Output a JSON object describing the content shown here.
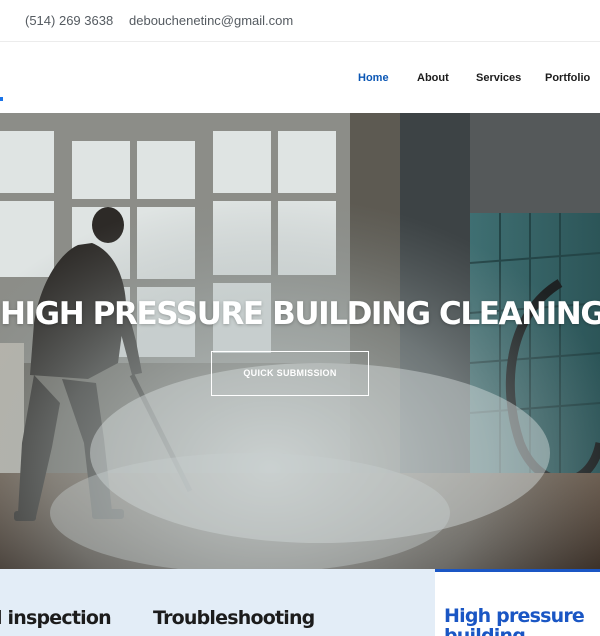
{
  "topbar": {
    "left_fragment": "l",
    "phone": "(514) 269 3638",
    "email": "debouchenetinc@gmail.com"
  },
  "nav": {
    "items": [
      {
        "label": "Home",
        "active": true
      },
      {
        "label": "About",
        "active": false
      },
      {
        "label": "Services",
        "active": false
      },
      {
        "label": "Portfolio",
        "active": false
      }
    ]
  },
  "hero": {
    "title": "HIGH PRESSURE BUILDING CLEANING",
    "button_label": "QUICK SUBMISSION"
  },
  "bottom": {
    "items": [
      {
        "title": "l inspection"
      },
      {
        "title": "Troubleshooting"
      },
      {
        "title": "High pressure building cleaning"
      }
    ]
  },
  "colors": {
    "accent": "#1a56c4",
    "nav_active": "#0b57b5",
    "band": "#e3edf7"
  }
}
